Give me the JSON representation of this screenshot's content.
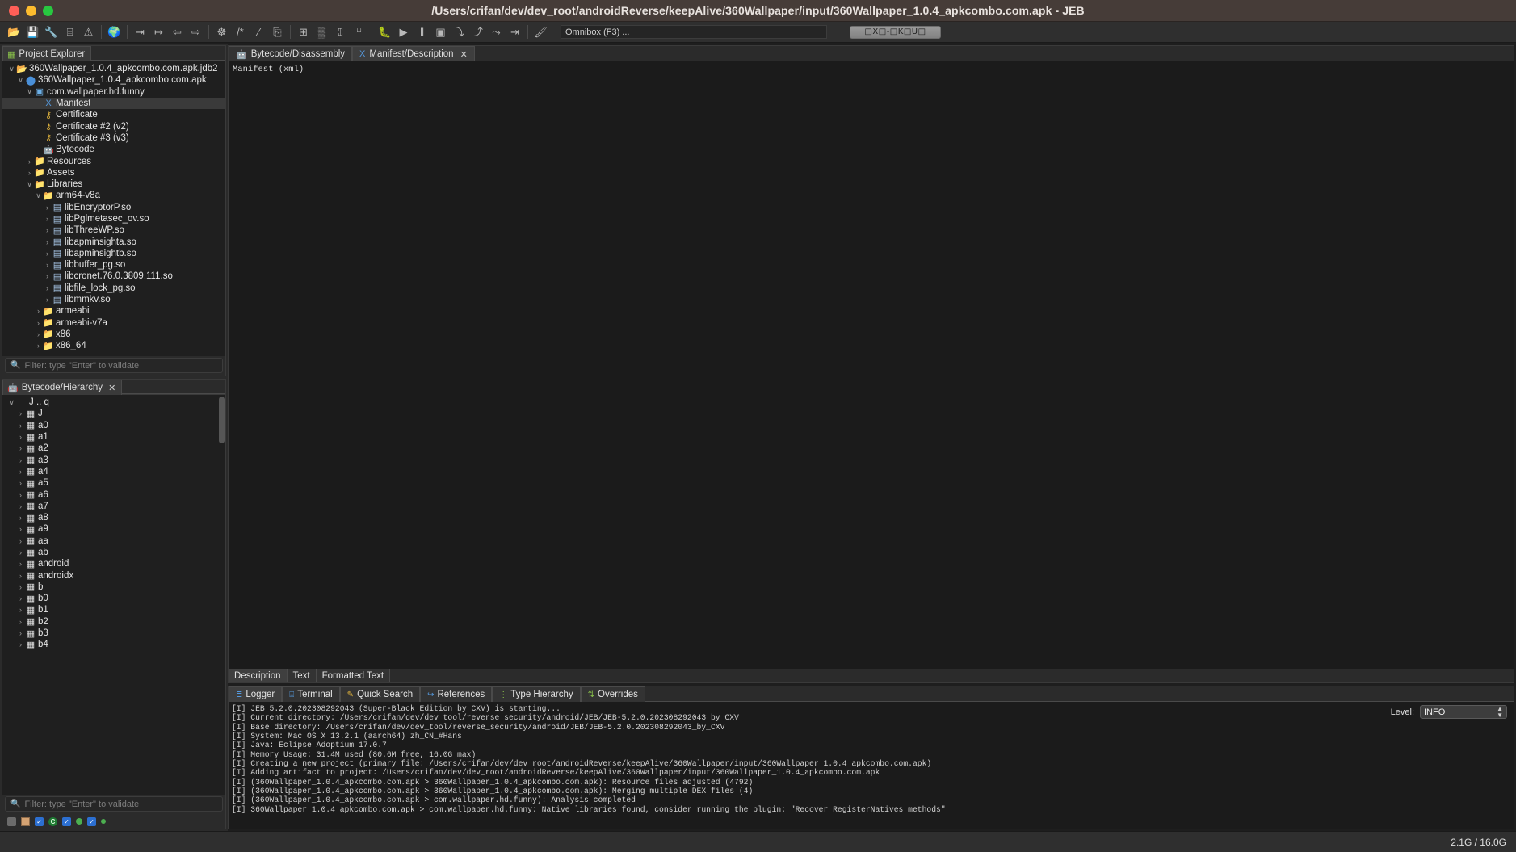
{
  "window": {
    "title": "/Users/crifan/dev/dev_root/androidReverse/keepAlive/360Wallpaper/input/360Wallpaper_1.0.4_apkcombo.com.apk - JEB"
  },
  "toolbar": {
    "icons": [
      {
        "name": "open-folder-icon",
        "glyph": "📂"
      },
      {
        "name": "save-icon",
        "glyph": "💾"
      },
      {
        "name": "wrench-icon",
        "glyph": "🔧"
      },
      {
        "name": "print-icon",
        "glyph": "⌸"
      },
      {
        "name": "warning-icon",
        "glyph": "⚠"
      },
      {
        "name": "sep1",
        "glyph": "|"
      },
      {
        "name": "globe-icon",
        "glyph": "🌍"
      },
      {
        "name": "sep2",
        "glyph": "|"
      },
      {
        "name": "goto-address-icon",
        "glyph": "⇥"
      },
      {
        "name": "goto-offset-icon",
        "glyph": "↦"
      },
      {
        "name": "navigate-back-icon",
        "glyph": "⇦"
      },
      {
        "name": "navigate-forward-icon",
        "glyph": "⇨"
      },
      {
        "name": "sep3",
        "glyph": "|"
      },
      {
        "name": "graph-icon",
        "glyph": "☸"
      },
      {
        "name": "comment-icon",
        "glyph": "/*"
      },
      {
        "name": "rename-icon",
        "glyph": "∕"
      },
      {
        "name": "export-icon",
        "glyph": "⎘"
      },
      {
        "name": "sep4",
        "glyph": "|"
      },
      {
        "name": "table-icon",
        "glyph": "⊞"
      },
      {
        "name": "decompile-icon",
        "glyph": "▒"
      },
      {
        "name": "hierarchy-icon",
        "glyph": "⑄"
      },
      {
        "name": "callgraph-icon",
        "glyph": "⑂"
      },
      {
        "name": "sep5",
        "glyph": "|"
      },
      {
        "name": "debug-icon",
        "glyph": "🐛"
      },
      {
        "name": "run-icon",
        "glyph": "▶"
      },
      {
        "name": "pause-icon",
        "glyph": "‖"
      },
      {
        "name": "stop-icon",
        "glyph": "▣"
      },
      {
        "name": "step-into-icon",
        "glyph": "⤵"
      },
      {
        "name": "step-over-icon",
        "glyph": "⤴"
      },
      {
        "name": "step-out-icon",
        "glyph": "⤳"
      },
      {
        "name": "run-to-cursor-icon",
        "glyph": "⇥"
      },
      {
        "name": "sep6",
        "glyph": "|"
      },
      {
        "name": "plugin-rocket-icon",
        "glyph": "🖌"
      }
    ],
    "omnibox_placeholder": "Omnibox (F3) ...",
    "cjk_button_label": "□X□-□K□U□"
  },
  "project_explorer": {
    "tab_label": "Project Explorer",
    "tab_icon": "project-icon",
    "filter_placeholder": "Filter: type \"Enter\" to validate",
    "nodes": [
      {
        "indent": 0,
        "twisty": "∨",
        "icon": "📂",
        "color": "#d9a441",
        "label": "360Wallpaper_1.0.4_apkcombo.com.apk.jdb2",
        "selected": false
      },
      {
        "indent": 1,
        "twisty": "∨",
        "icon": "⬤",
        "color": "#4a90d9",
        "label": "360Wallpaper_1.0.4_apkcombo.com.apk",
        "selected": false
      },
      {
        "indent": 2,
        "twisty": "∨",
        "icon": "▣",
        "color": "#6cb0e8",
        "label": "com.wallpaper.hd.funny",
        "selected": false
      },
      {
        "indent": 3,
        "twisty": "",
        "icon": "X",
        "color": "#5599dd",
        "label": "Manifest",
        "selected": true
      },
      {
        "indent": 3,
        "twisty": "",
        "icon": "⚷",
        "color": "#e0b33c",
        "label": "Certificate",
        "selected": false
      },
      {
        "indent": 3,
        "twisty": "",
        "icon": "⚷",
        "color": "#e0b33c",
        "label": "Certificate #2 (v2)",
        "selected": false
      },
      {
        "indent": 3,
        "twisty": "",
        "icon": "⚷",
        "color": "#e0b33c",
        "label": "Certificate #3 (v3)",
        "selected": false
      },
      {
        "indent": 3,
        "twisty": "",
        "icon": "🤖",
        "color": "#8ac34a",
        "label": "Bytecode",
        "selected": false
      },
      {
        "indent": 2,
        "twisty": "›",
        "icon": "📁",
        "color": "#d9a441",
        "label": "Resources",
        "selected": false
      },
      {
        "indent": 2,
        "twisty": "›",
        "icon": "📁",
        "color": "#d9a441",
        "label": "Assets",
        "selected": false
      },
      {
        "indent": 2,
        "twisty": "∨",
        "icon": "📁",
        "color": "#d9a441",
        "label": "Libraries",
        "selected": false
      },
      {
        "indent": 3,
        "twisty": "∨",
        "icon": "📁",
        "color": "#d9a441",
        "label": "arm64-v8a",
        "selected": false
      },
      {
        "indent": 4,
        "twisty": "›",
        "icon": "▤",
        "color": "#a8c7e8",
        "label": "libEncryptorP.so",
        "selected": false
      },
      {
        "indent": 4,
        "twisty": "›",
        "icon": "▤",
        "color": "#a8c7e8",
        "label": "libPglmetasec_ov.so",
        "selected": false
      },
      {
        "indent": 4,
        "twisty": "›",
        "icon": "▤",
        "color": "#a8c7e8",
        "label": "libThreeWP.so",
        "selected": false
      },
      {
        "indent": 4,
        "twisty": "›",
        "icon": "▤",
        "color": "#a8c7e8",
        "label": "libapminsighta.so",
        "selected": false
      },
      {
        "indent": 4,
        "twisty": "›",
        "icon": "▤",
        "color": "#a8c7e8",
        "label": "libapminsightb.so",
        "selected": false
      },
      {
        "indent": 4,
        "twisty": "›",
        "icon": "▤",
        "color": "#a8c7e8",
        "label": "libbuffer_pg.so",
        "selected": false
      },
      {
        "indent": 4,
        "twisty": "›",
        "icon": "▤",
        "color": "#a8c7e8",
        "label": "libcronet.76.0.3809.111.so",
        "selected": false
      },
      {
        "indent": 4,
        "twisty": "›",
        "icon": "▤",
        "color": "#a8c7e8",
        "label": "libfile_lock_pg.so",
        "selected": false
      },
      {
        "indent": 4,
        "twisty": "›",
        "icon": "▤",
        "color": "#a8c7e8",
        "label": "libmmkv.so",
        "selected": false
      },
      {
        "indent": 3,
        "twisty": "›",
        "icon": "📁",
        "color": "#d9a441",
        "label": "armeabi",
        "selected": false
      },
      {
        "indent": 3,
        "twisty": "›",
        "icon": "📁",
        "color": "#d9a441",
        "label": "armeabi-v7a",
        "selected": false
      },
      {
        "indent": 3,
        "twisty": "›",
        "icon": "📁",
        "color": "#d9a441",
        "label": "x86",
        "selected": false
      },
      {
        "indent": 3,
        "twisty": "›",
        "icon": "📁",
        "color": "#d9a441",
        "label": "x86_64",
        "selected": false
      }
    ]
  },
  "hierarchy_panel": {
    "tab_label": "Bytecode/Hierarchy",
    "tab_icon": "android-icon",
    "tab_close": "✕",
    "filter_placeholder": "Filter: type \"Enter\" to validate",
    "nodes": [
      {
        "indent": 0,
        "twisty": "∨",
        "icon": "",
        "label": "J .. q"
      },
      {
        "indent": 1,
        "twisty": "›",
        "icon": "▦",
        "label": "J"
      },
      {
        "indent": 1,
        "twisty": "›",
        "icon": "▦",
        "label": "a0"
      },
      {
        "indent": 1,
        "twisty": "›",
        "icon": "▦",
        "label": "a1"
      },
      {
        "indent": 1,
        "twisty": "›",
        "icon": "▦",
        "label": "a2"
      },
      {
        "indent": 1,
        "twisty": "›",
        "icon": "▦",
        "label": "a3"
      },
      {
        "indent": 1,
        "twisty": "›",
        "icon": "▦",
        "label": "a4"
      },
      {
        "indent": 1,
        "twisty": "›",
        "icon": "▦",
        "label": "a5"
      },
      {
        "indent": 1,
        "twisty": "›",
        "icon": "▦",
        "label": "a6"
      },
      {
        "indent": 1,
        "twisty": "›",
        "icon": "▦",
        "label": "a7"
      },
      {
        "indent": 1,
        "twisty": "›",
        "icon": "▦",
        "label": "a8"
      },
      {
        "indent": 1,
        "twisty": "›",
        "icon": "▦",
        "label": "a9"
      },
      {
        "indent": 1,
        "twisty": "›",
        "icon": "▦",
        "label": "aa"
      },
      {
        "indent": 1,
        "twisty": "›",
        "icon": "▦",
        "label": "ab"
      },
      {
        "indent": 1,
        "twisty": "›",
        "icon": "▦",
        "label": "android"
      },
      {
        "indent": 1,
        "twisty": "›",
        "icon": "▦",
        "label": "androidx"
      },
      {
        "indent": 1,
        "twisty": "›",
        "icon": "▦",
        "label": "b"
      },
      {
        "indent": 1,
        "twisty": "›",
        "icon": "▦",
        "label": "b0"
      },
      {
        "indent": 1,
        "twisty": "›",
        "icon": "▦",
        "label": "b1"
      },
      {
        "indent": 1,
        "twisty": "›",
        "icon": "▦",
        "label": "b2"
      },
      {
        "indent": 1,
        "twisty": "›",
        "icon": "▦",
        "label": "b3"
      },
      {
        "indent": 1,
        "twisty": "›",
        "icon": "▦",
        "label": "b4"
      }
    ],
    "toolbar_items": [
      {
        "name": "collapse-toggle-icon",
        "kind": "gray-square"
      },
      {
        "name": "package-grid-icon",
        "kind": "grid"
      },
      {
        "name": "show-classes-checkbox",
        "kind": "checkbox",
        "checked": true
      },
      {
        "name": "class-marker-icon",
        "kind": "c-circle"
      },
      {
        "name": "show-methods-checkbox",
        "kind": "checkbox",
        "checked": true
      },
      {
        "name": "method-marker-icon",
        "kind": "dot"
      },
      {
        "name": "show-fields-checkbox",
        "kind": "checkbox",
        "checked": true
      },
      {
        "name": "field-marker-icon",
        "kind": "dot-small"
      }
    ]
  },
  "editor": {
    "tabs": [
      {
        "label": "Bytecode/Disassembly",
        "icon": "android-icon",
        "active": false,
        "closable": false
      },
      {
        "label": "Manifest/Description",
        "icon": "xml-icon",
        "active": true,
        "closable": true
      }
    ],
    "content": "Manifest (xml)",
    "bottom_tabs": [
      "Description",
      "Text",
      "Formatted Text"
    ],
    "bottom_active": "Description"
  },
  "log_panel": {
    "tabs": [
      {
        "label": "Logger",
        "icon": "log-icon",
        "active": true
      },
      {
        "label": "Terminal",
        "icon": "terminal-icon",
        "active": false
      },
      {
        "label": "Quick Search",
        "icon": "pencil-icon",
        "active": false
      },
      {
        "label": "References",
        "icon": "references-icon",
        "active": false
      },
      {
        "label": "Type Hierarchy",
        "icon": "type-hierarchy-icon",
        "active": false
      },
      {
        "label": "Overrides",
        "icon": "overrides-icon",
        "active": false
      }
    ],
    "level_label": "Level:",
    "level_value": "INFO",
    "lines": [
      "[I] JEB 5.2.0.202308292043 (Super-Black Edition by CXV) is starting...",
      "[I] Current directory: /Users/crifan/dev/dev_tool/reverse_security/android/JEB/JEB-5.2.0.202308292043_by_CXV",
      "[I] Base directory: /Users/crifan/dev/dev_tool/reverse_security/android/JEB/JEB-5.2.0.202308292043_by_CXV",
      "[I] System: Mac OS X 13.2.1 (aarch64) zh_CN_#Hans",
      "[I] Java: Eclipse Adoptium 17.0.7",
      "[I] Memory Usage: 31.4M used (80.6M free, 16.0G max)",
      "[I] Creating a new project (primary file: /Users/crifan/dev/dev_root/androidReverse/keepAlive/360Wallpaper/input/360Wallpaper_1.0.4_apkcombo.com.apk)",
      "[I] Adding artifact to project: /Users/crifan/dev/dev_root/androidReverse/keepAlive/360Wallpaper/input/360Wallpaper_1.0.4_apkcombo.com.apk",
      "[I] (360Wallpaper_1.0.4_apkcombo.com.apk > 360Wallpaper_1.0.4_apkcombo.com.apk): Resource files adjusted (4792)",
      "[I] (360Wallpaper_1.0.4_apkcombo.com.apk > 360Wallpaper_1.0.4_apkcombo.com.apk): Merging multiple DEX files (4)",
      "[I] (360Wallpaper_1.0.4_apkcombo.com.apk > com.wallpaper.hd.funny): Analysis completed",
      "[I] 360Wallpaper_1.0.4_apkcombo.com.apk > com.wallpaper.hd.funny: Native libraries found, consider running the plugin: \"Recover RegisterNatives methods\""
    ]
  },
  "statusbar": {
    "memory": "2.1G / 16.0G"
  }
}
